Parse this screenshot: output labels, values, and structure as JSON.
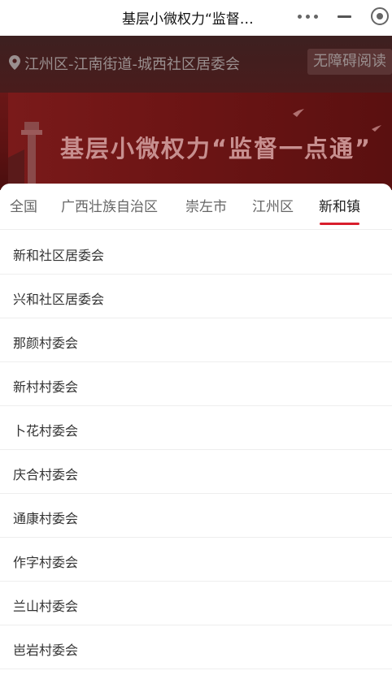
{
  "nav": {
    "title": "基层小微权力“监督…"
  },
  "location": {
    "path": "江州区-江南街道-城西社区居委会",
    "accessibility_label": "无障碍阅读"
  },
  "banner": {
    "title": "基层小微权力“监督一点通”"
  },
  "tabs": [
    {
      "label": "全国"
    },
    {
      "label": "广西壮族自治区"
    },
    {
      "label": "崇左市"
    },
    {
      "label": "江州区"
    },
    {
      "label": "新和镇"
    }
  ],
  "active_tab": "新和镇",
  "items": [
    {
      "label": "新和社区居委会"
    },
    {
      "label": "兴和社区居委会"
    },
    {
      "label": "那颜村委会"
    },
    {
      "label": "新村村委会"
    },
    {
      "label": "卜花村委会"
    },
    {
      "label": "庆合村委会"
    },
    {
      "label": "通康村委会"
    },
    {
      "label": "作字村委会"
    },
    {
      "label": "兰山村委会"
    },
    {
      "label": "岜岩村委会"
    }
  ],
  "colors": {
    "accent": "#d81e2c",
    "band": "#4a1c1c",
    "banner": "#6a1717"
  },
  "icons": {
    "location": "map-pin-icon",
    "more": "more-dots-icon",
    "minimize": "minimize-icon",
    "close": "target-close-icon"
  }
}
